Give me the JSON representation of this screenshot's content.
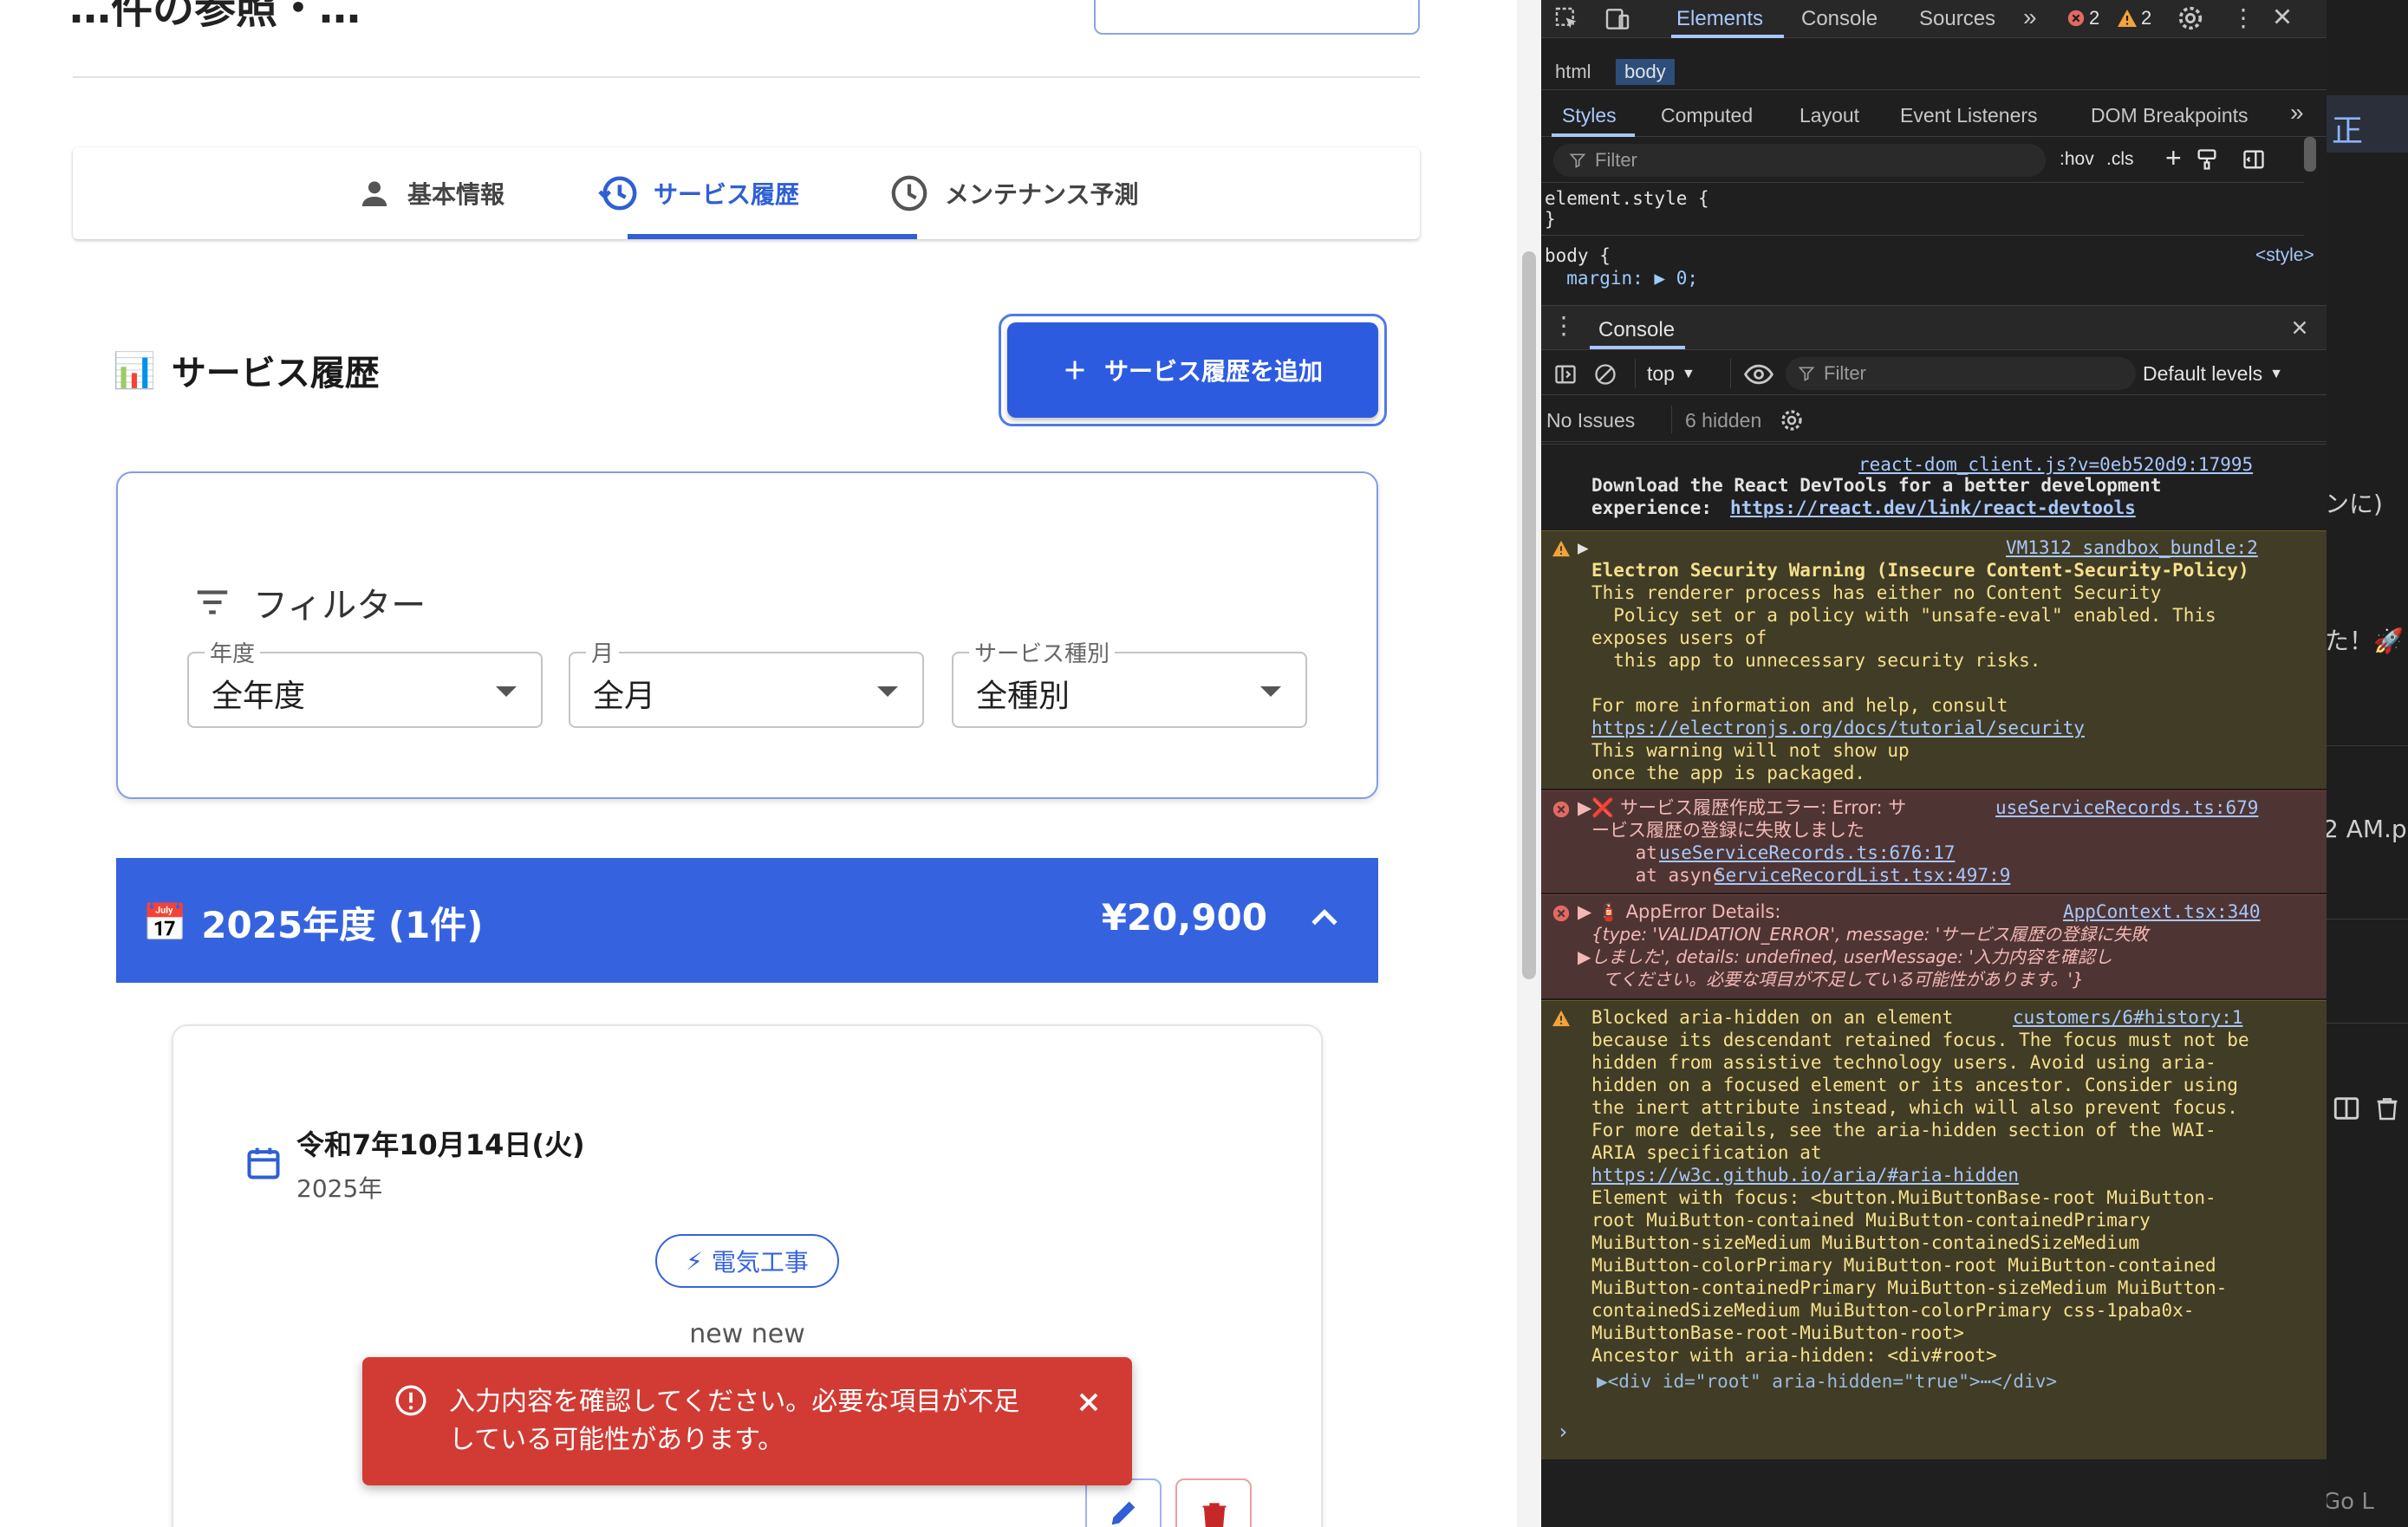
{
  "app": {
    "title_fragment": "…件の参照・…",
    "tabs": [
      {
        "label": "基本情報",
        "icon": "person-icon"
      },
      {
        "label": "サービス履歴",
        "icon": "history-icon"
      },
      {
        "label": "メンテナンス予測",
        "icon": "clock-icon"
      }
    ],
    "section_title": "サービス履歴",
    "section_icon": "📊",
    "add_button_label": "サービス履歴を追加",
    "filter": {
      "heading": "フィルター",
      "year": {
        "label": "年度",
        "value": "全年度"
      },
      "month": {
        "label": "月",
        "value": "全月"
      },
      "service_type": {
        "label": "サービス種別",
        "value": "全種別"
      }
    },
    "year_group": {
      "icon": "📅",
      "title": "2025年度 (1件)",
      "total": "¥20,900"
    },
    "record": {
      "date": "令和7年10月14日(火)",
      "year": "2025年",
      "chip_icon": "⚡",
      "chip_label": "電気工事",
      "description": "new new"
    },
    "snackbar": {
      "message": "入力内容を確認してください。必要な項目が不足している可能性があります。"
    }
  },
  "devtools": {
    "tabs": [
      "Elements",
      "Console",
      "Sources"
    ],
    "error_count": "2",
    "warning_count": "2",
    "breadcrumb": [
      "html",
      "body"
    ],
    "style_tabs": [
      "Styles",
      "Computed",
      "Layout",
      "Event Listeners",
      "DOM Breakpoints"
    ],
    "styles_filter_placeholder": "Filter",
    "hov": ":hov",
    "cls": ".cls",
    "styles_lines": [
      "element.style {",
      "}",
      "body {",
      "  margin: ▶ 0;"
    ],
    "style_source": "<style>",
    "drawer_title": "Console",
    "context": "top",
    "console_filter_placeholder": "Filter",
    "levels": "Default levels",
    "issues": "No Issues",
    "hidden": "6 hidden",
    "messages": {
      "m1_source": "react-dom_client.js?v=0eb520d9:17995",
      "m1_line1": "Download the React DevTools for a better development",
      "m1_line2": "experience: ",
      "m1_link": "https://react.dev/link/react-devtools",
      "m2_source": "VM1312 sandbox_bundle:2",
      "m2_lines": [
        "Electron Security Warning (Insecure Content-Security-Policy)",
        "This renderer process has either no Content Security",
        "  Policy set or a policy with \"unsafe-eval\" enabled. This",
        "exposes users of",
        "  this app to unnecessary security risks.",
        "",
        "For more information and help, consult"
      ],
      "m2_link": "https://electronjs.org/docs/tutorial/security",
      "m2_tail": [
        "This warning will not show up",
        "once the app is packaged."
      ],
      "m3_source": "useServiceRecords.ts:679",
      "m3_line1": "▶❌ サービス履歴作成エラー: Error: サ",
      "m3_line2": "ービス履歴の登録に失敗しました",
      "m3_at1_prefix": "    at ",
      "m3_at1": "useServiceRecords.ts:676:17",
      "m3_at2_prefix": "    at async ",
      "m3_at2": "ServiceRecordList.tsx:497:9",
      "m4_source": "AppContext.tsx:340",
      "m4_line1": "▶ 🧯 AppError Details:",
      "m4_line2": "{type: 'VALIDATION_ERROR', message: 'サービス履歴の登録に失敗",
      "m4_line3": "▶しました', details: undefined, userMessage: '入力内容を確認し",
      "m4_line4": "  てください。必要な項目が不足している可能性があります。'}",
      "m5_source": "customers/6#history:1",
      "m5_lines": [
        "Blocked aria-hidden on an element",
        "because its descendant retained focus. The focus must not be",
        "hidden from assistive technology users. Avoid using aria-",
        "hidden on a focused element or its ancestor. Consider using",
        "the inert attribute instead, which will also prevent focus.",
        "For more details, see the aria-hidden section of the WAI-",
        "ARIA specification at"
      ],
      "m5_link": "https://w3c.github.io/aria/#aria-hidden",
      "m5_tail": [
        "Element with focus: <button.MuiButtonBase-root MuiButton-",
        "root MuiButton-contained MuiButton-containedPrimary",
        "MuiButton-sizeMedium MuiButton-containedSizeMedium",
        "MuiButton-colorPrimary MuiButton-root MuiButton-contained",
        "MuiButton-containedPrimary MuiButton-sizeMedium MuiButton-",
        "containedSizeMedium MuiButton-colorPrimary css-1paba0x-",
        "MuiButtonBase-root-MuiButton-root>",
        "Ancestor with aria-hidden: <div#root>"
      ],
      "m5_node": "▶<div id=\"root\" aria-hidden=\"true\">⋯</div>"
    },
    "prompt": "›"
  },
  "strip": {
    "texts": [
      "正",
      "ンに)",
      "た！🚀",
      "2 AM.p",
      "Go L"
    ]
  },
  "colors": {
    "primary": "#3563e0",
    "error": "#d13b34",
    "devtools_bg": "#1f1f1f",
    "warn_bg": "#413c26",
    "err_bg": "#4e3534",
    "link": "#a8c7fa"
  }
}
